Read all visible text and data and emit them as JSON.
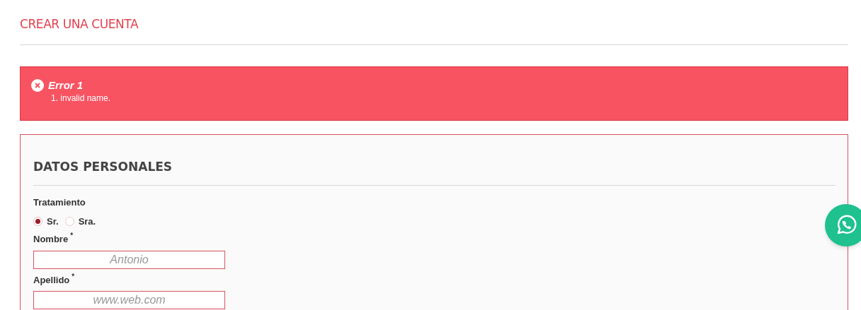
{
  "page_title": "CREAR UNA CUENTA",
  "error": {
    "title": "Error 1",
    "messages": [
      "1. invalid name."
    ]
  },
  "form": {
    "heading": "DATOS PERSONALES",
    "title_label": "Tratamiento",
    "title_options": [
      {
        "label": "Sr.",
        "selected": true
      },
      {
        "label": "Sra.",
        "selected": false
      }
    ],
    "fields": [
      {
        "label": "Nombre",
        "required_mark": "*",
        "placeholder": "Antonio"
      },
      {
        "label": "Apellido",
        "required_mark": "*",
        "placeholder": "www.web.com"
      }
    ]
  }
}
